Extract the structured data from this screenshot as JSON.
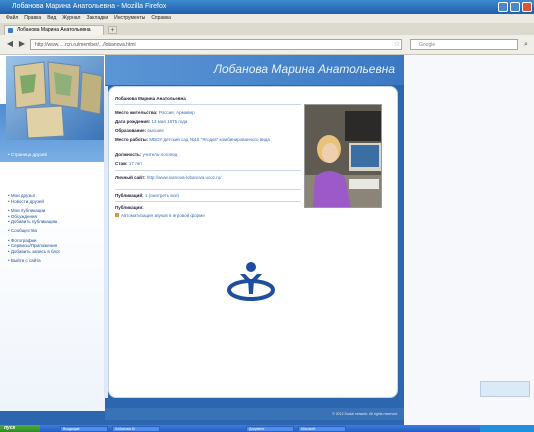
{
  "window": {
    "title": "Лобанова Марина Анатольевна - Mozilla Firefox"
  },
  "menu": [
    "Файл",
    "Правка",
    "Вид",
    "Журнал",
    "Закладки",
    "Инструменты",
    "Справка"
  ],
  "tabs": [
    {
      "label": "Лобанова Марина Анатольевна"
    }
  ],
  "address_bar": {
    "value": "http://www.....rcn.ru/member/.../lobanova.html"
  },
  "search_bar": {
    "placeholder": "Google"
  },
  "site": {
    "title": "Лобанова Марина Анатольевна",
    "left_nav_header": "Страница друзей",
    "left_nav": [
      "Мои друзья",
      "Новости друзей",
      "Мои публикации",
      "Обсуждения",
      "Добавить публикацию",
      "Сообщества",
      "Фотографии",
      "Сервисы/Приложения",
      "Добавить запись в блог",
      "Выйти с сайта"
    ],
    "profile": {
      "name": "Лобанова Марина Анатольевна",
      "fields": [
        {
          "label": "Место жительства:",
          "value": "Россия, Армавир"
        },
        {
          "label": "Дата рождения:",
          "value": "13 мая 1975 года"
        },
        {
          "label": "Образование:",
          "value": "высшее"
        },
        {
          "label": "Место работы:",
          "value": "МБОУ детский сад №15 \"Ягодка\" комбинированного вида"
        },
        {
          "label": "Должность:",
          "value": "учитель-логопед"
        },
        {
          "label": "Стаж:",
          "value": "17 лет"
        },
        {
          "label": "Личный сайт:",
          "value": "http://www.ivanova-lobanova.ucoz.ru/"
        },
        {
          "label": "Публикаций:",
          "value": "1 (смотреть все)"
        },
        {
          "label": "Публикации:",
          "value": ""
        }
      ],
      "publication_link": "Автоматизация звуков в игровой форме"
    },
    "footer": "© 2012 Social network. All rights reserved."
  },
  "taskbar": {
    "start": "пуск",
    "items": [
      "Входящие",
      "Лобанова М",
      "Документ",
      "Microsoft"
    ]
  },
  "colors": {
    "accent": "#3b78c2",
    "link": "#3a6ab0",
    "panel": "#ffffff"
  }
}
